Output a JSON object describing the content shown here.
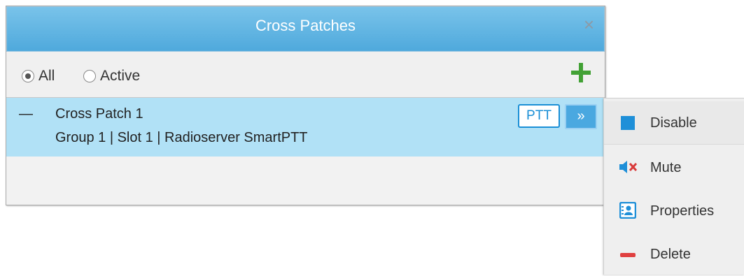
{
  "window": {
    "title": "Cross Patches"
  },
  "filter": {
    "options": [
      {
        "label": "All",
        "selected": true
      },
      {
        "label": "Active",
        "selected": false
      }
    ]
  },
  "patches": [
    {
      "collapse_glyph": "—",
      "name": "Cross Patch 1",
      "details": "Group 1 | Slot 1 | Radioserver SmartPTT",
      "ptt_label": "PTT",
      "more_glyph": "»"
    }
  ],
  "context_menu": {
    "items": [
      {
        "label": "Disable",
        "icon": "stop-square-icon"
      },
      {
        "label": "Mute",
        "icon": "speaker-mute-icon"
      },
      {
        "label": "Properties",
        "icon": "contact-card-icon"
      },
      {
        "label": "Delete",
        "icon": "minus-icon"
      }
    ]
  },
  "colors": {
    "titlebar": "#5db3e2",
    "selected_row": "#b1e1f6",
    "accent_blue": "#1a8fd6",
    "add_green": "#42a135",
    "delete_red": "#e04040"
  }
}
